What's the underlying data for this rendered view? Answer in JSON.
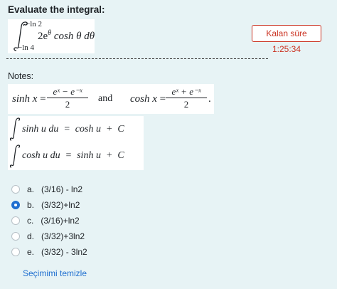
{
  "question": {
    "title": "Evaluate the integral:",
    "integral": {
      "upper_limit": "−ln 2",
      "lower_limit": "−ln 4",
      "integrand_coef": "2e",
      "integrand_exp": "θ",
      "integrand_rest": "cosh θ dθ"
    }
  },
  "timer": {
    "label": "Kalan süre 1:25:34"
  },
  "notes": {
    "label": "Notes:",
    "sinh_def": {
      "lhs": "sinh x",
      "num": "eˣ − e⁻ˣ",
      "den": "2"
    },
    "and_word": "and",
    "cosh_def": {
      "lhs": "cosh x",
      "num": "eˣ + e⁻ˣ",
      "den": "2",
      "end": "."
    },
    "identity1": "sinh u du  =  cosh u  +  C",
    "identity2": "cosh u du  =  sinh u  +  C"
  },
  "options": [
    {
      "letter": "a.",
      "text": "(3/16) - ln2",
      "selected": false
    },
    {
      "letter": "b.",
      "text": "(3/32)+ln2",
      "selected": true
    },
    {
      "letter": "c.",
      "text": "(3/16)+ln2",
      "selected": false
    },
    {
      "letter": "d.",
      "text": "(3/32)+3ln2",
      "selected": false
    },
    {
      "letter": "e.",
      "text": "(3/32) - 3ln2",
      "selected": false
    }
  ],
  "clear_choice": "Seçimimi temizle",
  "colors": {
    "background": "#e7f3f5",
    "timer": "#ca3120",
    "accent": "#1f6fd0"
  }
}
